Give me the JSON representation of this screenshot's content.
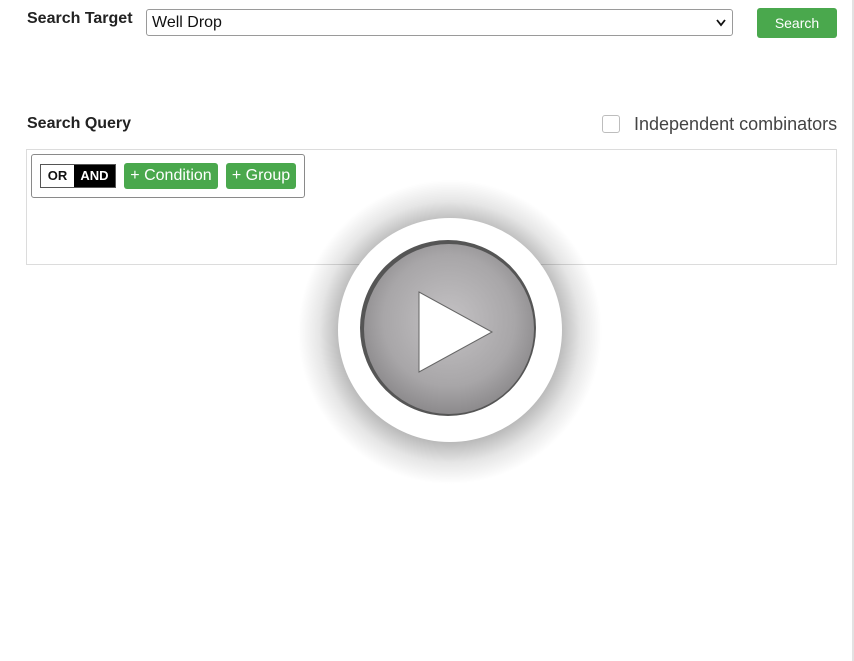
{
  "search_target": {
    "label": "Search Target",
    "selected": "Well Drop",
    "button_label": "Search"
  },
  "search_query": {
    "label": "Search Query",
    "independent_combinators_label": "Independent combinators",
    "independent_combinators_checked": false,
    "combinator": {
      "or_label": "OR",
      "and_label": "AND",
      "active": "AND"
    },
    "add_condition_label": "+ Condition",
    "add_group_label": "+ Group"
  },
  "overlay": {
    "icon": "play-icon"
  },
  "colors": {
    "accent_green": "#4aa84d",
    "combinator_active": "#000000"
  }
}
